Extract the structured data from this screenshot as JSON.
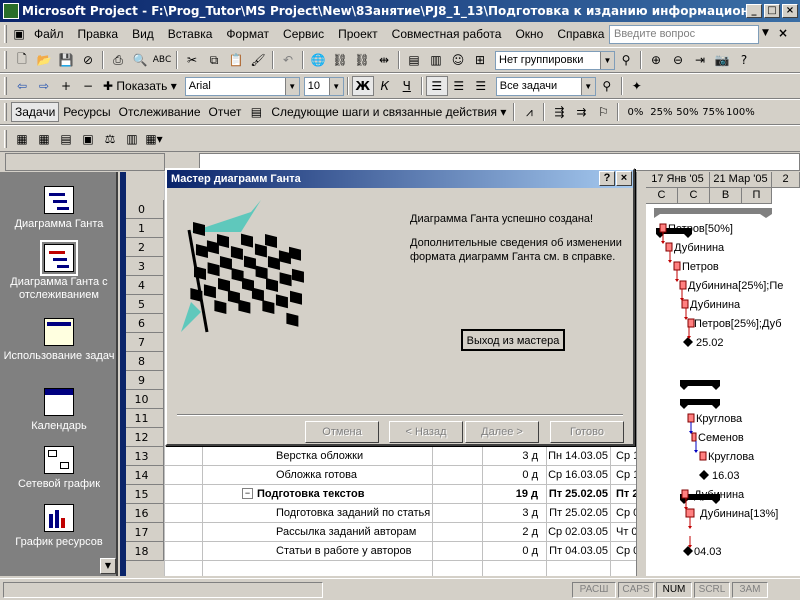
{
  "window": {
    "title": "Microsoft Project - F:\\Prog_Tutor\\MS Project\\New\\8Занятие\\PJ8_1_13\\Подготовка к изданию информационного бюллет..."
  },
  "menu": [
    "Файл",
    "Правка",
    "Вид",
    "Вставка",
    "Формат",
    "Сервис",
    "Проект",
    "Совместная работа",
    "Окно",
    "Справка"
  ],
  "help_search": {
    "placeholder": "Введите вопрос"
  },
  "toolbar1": {
    "grouping": "Нет группировки"
  },
  "toolbar2": {
    "show_label": "Показать",
    "font": "Arial",
    "size": "10",
    "bold": "Ж",
    "italic": "К",
    "underline": "Ч",
    "filter": "Все задачи"
  },
  "toolbar3": {
    "items": [
      "Задачи",
      "Ресурсы",
      "Отслеживание",
      "Отчет"
    ],
    "next_steps": "Следующие шаги и связанные действия",
    "percent_buttons": [
      "0%",
      "25%",
      "50%",
      "75%",
      "100%"
    ]
  },
  "viewbar": {
    "items": [
      {
        "label": "Диаграмма Ганта",
        "icon": "gantt-chart-icon"
      },
      {
        "label": "Диаграмма Ганта с отслеживанием",
        "icon": "tracking-gantt-icon"
      },
      {
        "label": "Использование задач",
        "icon": "task-usage-icon"
      },
      {
        "label": "Календарь",
        "icon": "calendar-icon"
      },
      {
        "label": "Сетевой график",
        "icon": "network-diagram-icon"
      },
      {
        "label": "График ресурсов",
        "icon": "resource-graph-icon"
      }
    ]
  },
  "sheet": {
    "rows": [
      {
        "id": "0",
        "name": "",
        "dur": "",
        "start": "",
        "finish": ""
      },
      {
        "id": "1",
        "name": "",
        "dur": "",
        "start": "",
        "finish": ""
      },
      {
        "id": "2",
        "name": "",
        "dur": "",
        "start": "",
        "finish": ""
      },
      {
        "id": "3",
        "name": "",
        "dur": "",
        "start": "",
        "finish": ""
      },
      {
        "id": "4",
        "name": "",
        "dur": "",
        "start": "",
        "finish": ""
      },
      {
        "id": "5",
        "name": "",
        "dur": "",
        "start": "",
        "finish": ""
      },
      {
        "id": "6",
        "name": "",
        "dur": "",
        "start": "",
        "finish": ""
      },
      {
        "id": "7",
        "name": "",
        "dur": "",
        "start": "",
        "finish": ""
      },
      {
        "id": "8",
        "name": "",
        "dur": "",
        "start": "",
        "finish": ""
      },
      {
        "id": "9",
        "name": "",
        "dur": "",
        "start": "",
        "finish": ""
      },
      {
        "id": "10",
        "name": "",
        "dur": "",
        "start": "",
        "finish": ""
      },
      {
        "id": "11",
        "name": "",
        "dur": "",
        "start": "",
        "finish": ""
      },
      {
        "id": "12",
        "name": "",
        "dur": "",
        "start": "",
        "finish": ""
      },
      {
        "id": "13",
        "name": "Верстка обложки",
        "dur": "3 д",
        "start": "Пн 14.03.05",
        "finish": "Ср 1"
      },
      {
        "id": "14",
        "name": "Обложка готова",
        "dur": "0 д",
        "start": "Ср 16.03.05",
        "finish": "Ср 1"
      },
      {
        "id": "15",
        "name": "Подготовка текстов",
        "dur": "19 д",
        "start": "Пт 25.02.05",
        "finish": "Пт 2"
      },
      {
        "id": "16",
        "name": "Подготовка заданий по статья",
        "dur": "3 д",
        "start": "Пт 25.02.05",
        "finish": "Ср 0"
      },
      {
        "id": "17",
        "name": "Рассылка заданий авторам",
        "dur": "2 д",
        "start": "Ср 02.03.05",
        "finish": "Чт 0"
      },
      {
        "id": "18",
        "name": "Статьи в работе у авторов",
        "dur": "0 д",
        "start": "Пт 04.03.05",
        "finish": "Ср 0"
      }
    ],
    "visible_tails": [
      "2",
      "2",
      "2",
      "2",
      "2",
      "2",
      "2",
      "2",
      "1",
      "1",
      "1",
      "1"
    ]
  },
  "gantt": {
    "dates": [
      "17 Янв '05",
      "21 Мар '05",
      "2"
    ],
    "days": [
      "С",
      "С",
      "В",
      "П"
    ],
    "labels": [
      "Петров[50%]",
      "Дубинина",
      "Петров",
      "Дубинина[25%];Пе",
      "Дубинина",
      "Петров[25%];Дуб",
      "25.02",
      "Круглова",
      "Семенов",
      "Круглова",
      "16.03",
      "Дубинина",
      "Дубинина[13%]",
      "04.03"
    ]
  },
  "dialog": {
    "title": "Мастер диаграмм Ганта",
    "success": "Диаграмма Ганта успешно создана!",
    "info": "Дополнительные сведения об изменении формата диаграмм Ганта см. в справке.",
    "exit_button": "Выход из мастера",
    "buttons": [
      "Отмена",
      "< Назад",
      "Далее >",
      "Готово"
    ]
  },
  "status": {
    "indicators": [
      "РАСШ",
      "CAPS",
      "NUM",
      "SCRL",
      "ЗАМ"
    ],
    "active": "NUM"
  }
}
